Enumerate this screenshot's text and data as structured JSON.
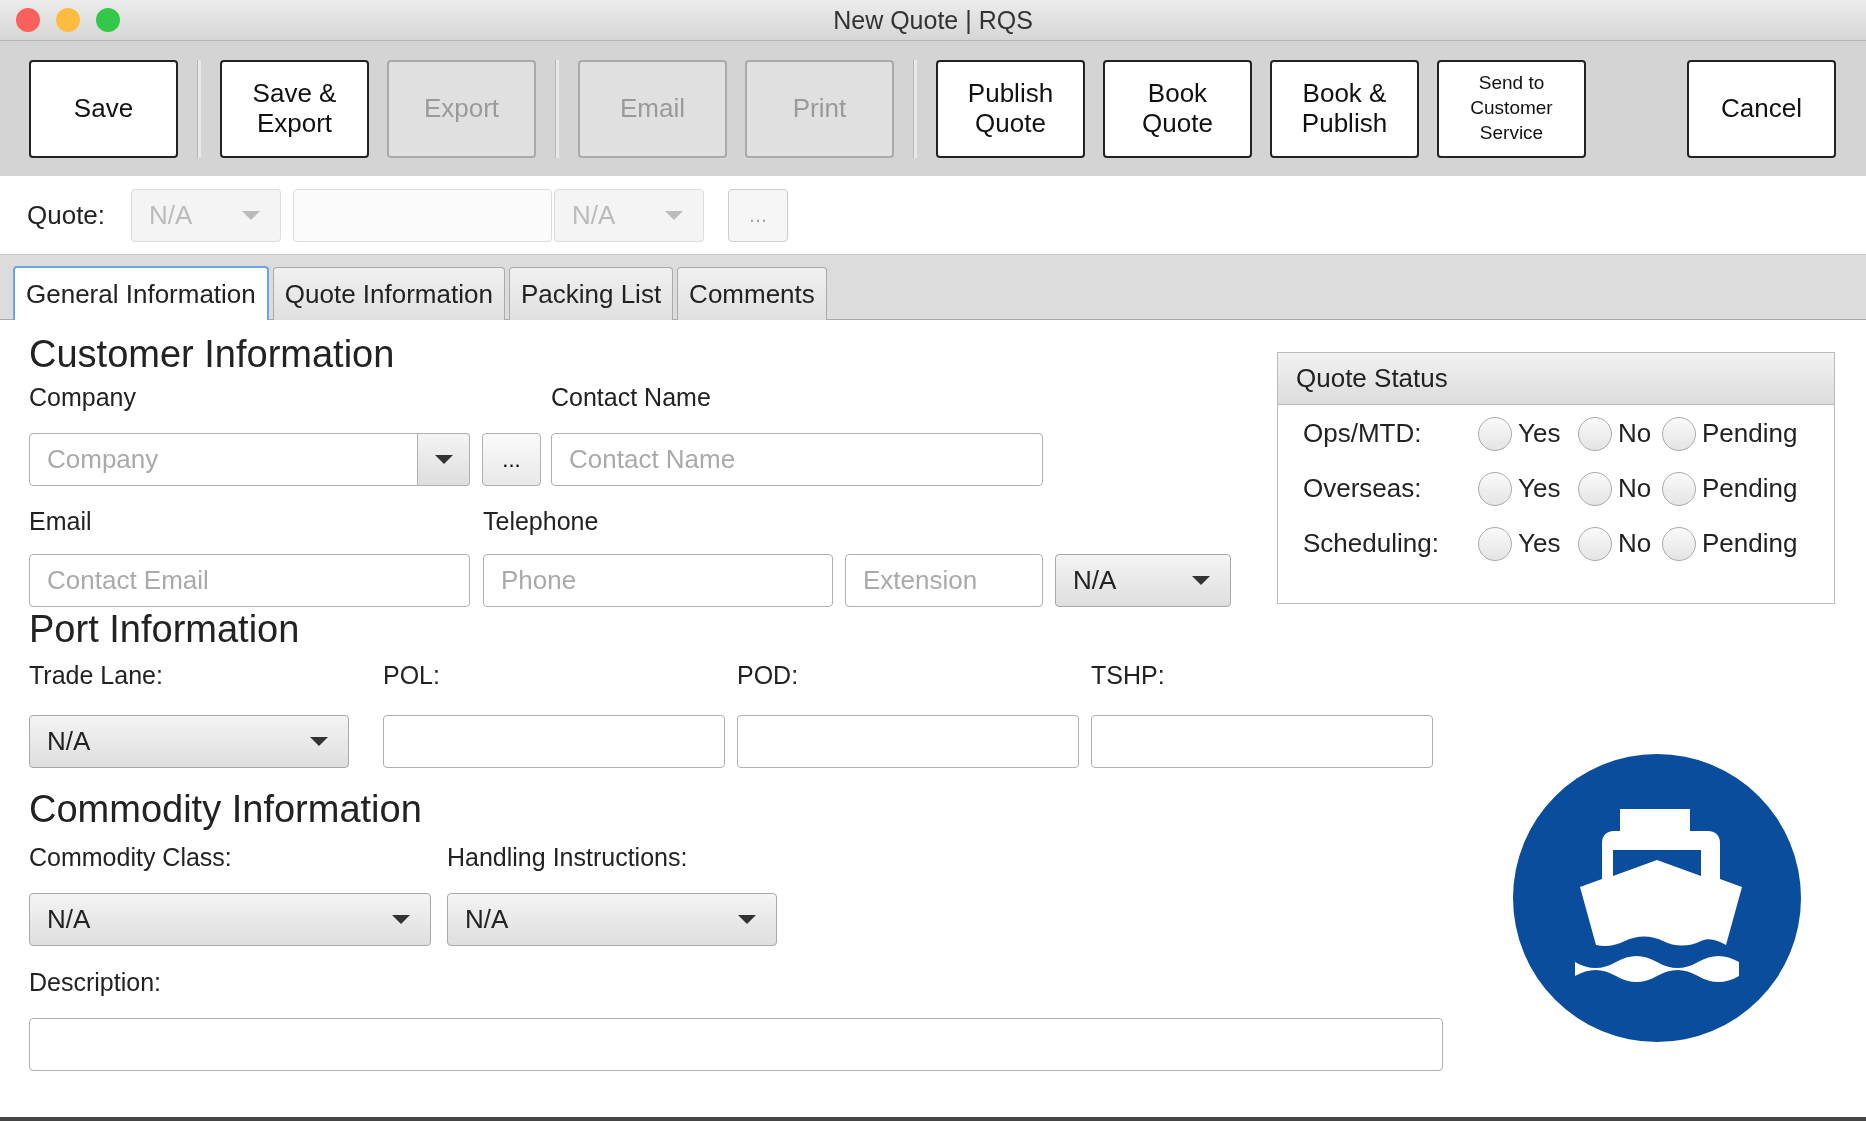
{
  "window": {
    "title": "New Quote | RQS"
  },
  "toolbar": {
    "buttons": [
      {
        "lines": [
          "Save"
        ],
        "disabled": false,
        "separator_before": false
      },
      {
        "lines": [
          "Save &",
          "Export"
        ],
        "disabled": false,
        "separator_before": true
      },
      {
        "lines": [
          "Export"
        ],
        "disabled": true,
        "separator_before": false
      },
      {
        "lines": [
          "Email"
        ],
        "disabled": true,
        "separator_before": true
      },
      {
        "lines": [
          "Print"
        ],
        "disabled": true,
        "separator_before": false
      },
      {
        "lines": [
          "Publish",
          "Quote"
        ],
        "disabled": false,
        "separator_before": true
      },
      {
        "lines": [
          "Book",
          "Quote"
        ],
        "disabled": false,
        "separator_before": false
      },
      {
        "lines": [
          "Book &",
          "Publish"
        ],
        "disabled": false,
        "separator_before": false
      },
      {
        "lines": [
          "Send to",
          "Customer",
          "Service"
        ],
        "disabled": false,
        "separator_before": false
      }
    ],
    "cancel": {
      "lines": [
        "Cancel"
      ],
      "disabled": false
    }
  },
  "quote_row": {
    "label": "Quote:",
    "controls": [
      {
        "kind": "combo",
        "value": "N/A",
        "disabled": true
      },
      {
        "kind": "text",
        "disabled": true
      },
      {
        "kind": "combo",
        "value": "N/A",
        "disabled": true
      },
      {
        "kind": "button",
        "label": "...",
        "disabled": true
      }
    ]
  },
  "tabs": [
    {
      "label": "General Information",
      "selected": true
    },
    {
      "label": "Quote Information",
      "selected": false
    },
    {
      "label": "Packing List",
      "selected": false
    },
    {
      "label": "Comments",
      "selected": false
    }
  ],
  "customer": {
    "heading": "Customer Information",
    "company": {
      "label": "Company",
      "placeholder": "Company",
      "button": "..."
    },
    "contact_name": {
      "label": "Contact Name",
      "placeholder": "Contact Name"
    },
    "email": {
      "label": "Email",
      "placeholder": "Contact Email"
    },
    "telephone": {
      "label": "Telephone",
      "phone": {
        "placeholder": "Phone"
      },
      "extension": {
        "placeholder": "Extension"
      },
      "type": {
        "value": "N/A"
      }
    }
  },
  "quote_status": {
    "title": "Quote Status",
    "rows": [
      {
        "label": "Ops/MTD:",
        "options": [
          {
            "label": "Yes",
            "selected": false
          },
          {
            "label": "No",
            "selected": false
          },
          {
            "label": "Pending",
            "selected": false
          }
        ]
      },
      {
        "label": "Overseas:",
        "options": [
          {
            "label": "Yes",
            "selected": false
          },
          {
            "label": "No",
            "selected": false
          },
          {
            "label": "Pending",
            "selected": false
          }
        ]
      },
      {
        "label": "Scheduling:",
        "options": [
          {
            "label": "Yes",
            "selected": false
          },
          {
            "label": "No",
            "selected": false
          },
          {
            "label": "Pending",
            "selected": false
          }
        ]
      }
    ]
  },
  "port": {
    "heading": "Port Information",
    "trade_lane": {
      "label": "Trade Lane:",
      "value": "N/A"
    },
    "pol": {
      "label": "POL:"
    },
    "pod": {
      "label": "POD:"
    },
    "tshp": {
      "label": "TSHP:"
    }
  },
  "commodity": {
    "heading": "Commodity Information",
    "commodity_class": {
      "label": "Commodity Class:",
      "value": "N/A"
    },
    "handling": {
      "label": "Handling Instructions:",
      "value": "N/A"
    },
    "description": {
      "label": "Description:"
    }
  }
}
